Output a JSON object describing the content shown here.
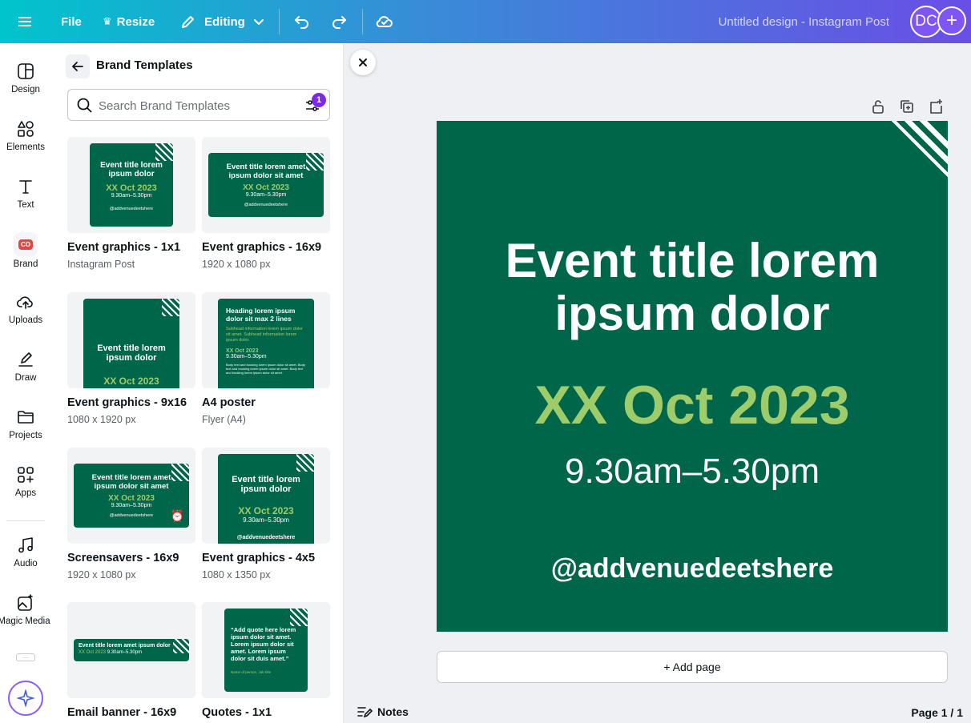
{
  "topbar": {
    "file": "File",
    "resize": "Resize",
    "editing": "Editing",
    "doc_title": "Untitled design - Instagram Post",
    "avatar": "DC",
    "plus": "+"
  },
  "rail": {
    "design": "Design",
    "elements": "Elements",
    "text": "Text",
    "brand": "Brand",
    "brand_badge": "CO",
    "uploads": "Uploads",
    "draw": "Draw",
    "projects": "Projects",
    "apps": "Apps",
    "audio": "Audio",
    "magic_media": "Magic Media",
    "more": "..."
  },
  "panel": {
    "title": "Brand Templates",
    "search_placeholder": "Search Brand Templates",
    "filter_badge": "1",
    "cards": [
      {
        "name": "Event graphics - 1x1",
        "sub": "Instagram Post",
        "t1": "Event title lorem ipsum dolor",
        "t2": "XX Oct 2023",
        "t3": "9.30am–5.30pm",
        "t4": "@addvenuedeetshere"
      },
      {
        "name": "Event graphics - 16x9",
        "sub": "1920 x 1080 px",
        "t1": "Event title lorem amet ipsum dolor sit amet",
        "t2": "XX Oct 2023",
        "t3": "9.30am–5.30pm",
        "t4": "@addvenuedeetshere"
      },
      {
        "name": "Event graphics - 9x16",
        "sub": "1080 x 1920 px",
        "t1": "Event title lorem ipsum dolor",
        "t2": "XX Oct 2023"
      },
      {
        "name": "A4 poster",
        "sub": "Flyer (A4)",
        "t1": "Heading lorem ipsum dolor sit max 2 lines",
        "t2": "Subhead information lorem ipsum dolor sit amet. Subhead information lorem ipsum dolor.",
        "t3": "XX Oct 2023",
        "t4": "9.30am–5.30pm",
        "t5": "Body text and booking lorem ipsum dolor sit amet. Body text and booking lorem ipsum dolor sit amet. Body text and booking lorem ipsum dolor sit amet."
      },
      {
        "name": "Screensavers - 16x9",
        "sub": "1920 x 1080 px",
        "t1": "Event title lorem amet ipsum dolor sit amet",
        "t2": "XX Oct 2023",
        "t3": "9.30am–5.30pm",
        "t4": "@addvenuedeetshere"
      },
      {
        "name": "Event graphics - 4x5",
        "sub": "1080 x 1350 px",
        "t1": "Event title lorem ipsum dolor",
        "t2": "XX Oct 2023",
        "t3": "9.30am–5.30pm",
        "t4": "@addvenuedeetshere"
      },
      {
        "name": "Email banner - 16x9",
        "sub": "",
        "t1": "Event title lorem amet ipsum dolor",
        "t2": "XX Oct 2023",
        "t3": "9.30am–5.30pm"
      },
      {
        "name": "Quotes - 1x1",
        "sub": "",
        "t1": "“Add quote here lorem ipsum dolor sit amet. Lorem ipsum dolor sit amet. Lorem ipsum dolor sit duis amet.”",
        "t2": "Name of person, Job title"
      }
    ]
  },
  "design": {
    "title_line1": "Event title lorem",
    "title_line2": "ipsum dolor",
    "date": "XX Oct 2023",
    "time": "9.30am–5.30pm",
    "handle": "@addvenuedeetshere"
  },
  "canvas": {
    "add_page": "+ Add page",
    "notes": "Notes",
    "page_indicator": "Page 1 / 1"
  },
  "colors": {
    "accent": "#7d2ae8",
    "design_bg": "#006649",
    "design_highlight": "#9fcc6b"
  }
}
